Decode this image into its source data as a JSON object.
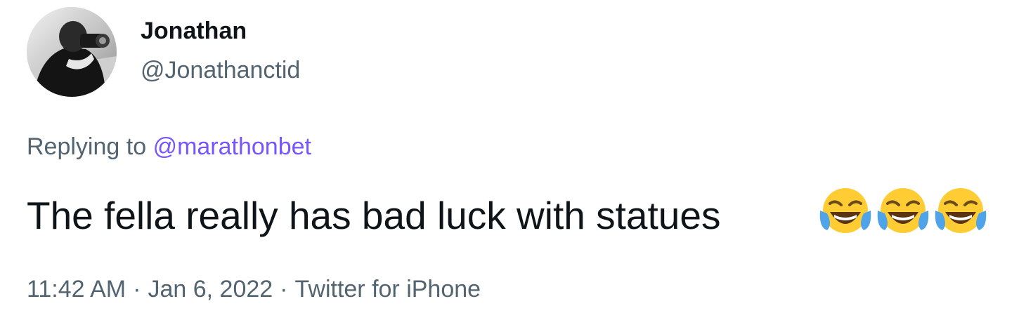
{
  "author": {
    "display_name": "Jonathan",
    "handle": "@Jonathanctid",
    "avatar_icon": "profile-photo-photographer"
  },
  "reply": {
    "prefix": "Replying to",
    "mention": "@marathonbet"
  },
  "tweet": {
    "text": "The fella really has bad luck with statues",
    "emojis": [
      "face-with-tears-of-joy",
      "face-with-tears-of-joy",
      "face-with-tears-of-joy"
    ]
  },
  "meta": {
    "time": "11:42 AM",
    "separator": "·",
    "date": "Jan 6, 2022",
    "source": "Twitter for iPhone"
  },
  "colors": {
    "text_primary": "#0f1419",
    "text_secondary": "#536471",
    "mention": "#7856ff",
    "background": "#ffffff"
  }
}
